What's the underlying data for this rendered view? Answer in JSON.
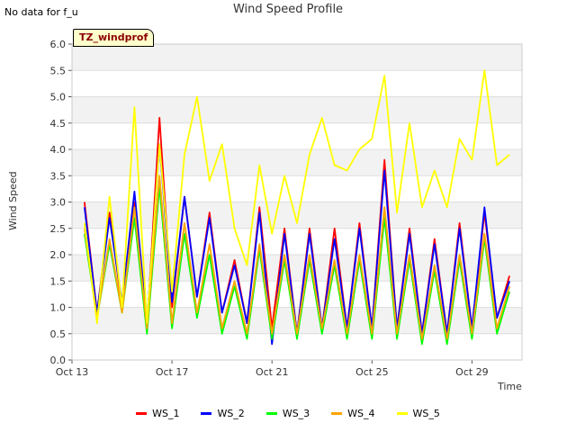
{
  "header": {
    "status_text": "No data for f_u",
    "badge_text": "TZ_windprof"
  },
  "chart_data": {
    "type": "line",
    "title": "Wind Speed Profile",
    "xlabel": "Time",
    "ylabel": "Wind Speed",
    "ylim": [
      0.0,
      6.0
    ],
    "yticks": [
      "0.0",
      "0.5",
      "1.0",
      "1.5",
      "2.0",
      "2.5",
      "3.0",
      "3.5",
      "4.0",
      "4.5",
      "5.0",
      "5.5",
      "6.0"
    ],
    "xlim": [
      "2023-10-13",
      "2023-10-31"
    ],
    "xticks": [
      {
        "label": "Oct 13",
        "date": "2023-10-13"
      },
      {
        "label": "Oct 17",
        "date": "2023-10-17"
      },
      {
        "label": "Oct 21",
        "date": "2023-10-21"
      },
      {
        "label": "Oct 25",
        "date": "2023-10-25"
      },
      {
        "label": "Oct 29",
        "date": "2023-10-29"
      }
    ],
    "grid": true,
    "legend_position": "bottom",
    "x": [
      "2023-10-13 12:00",
      "2023-10-14 00:00",
      "2023-10-14 12:00",
      "2023-10-15 00:00",
      "2023-10-15 12:00",
      "2023-10-16 00:00",
      "2023-10-16 12:00",
      "2023-10-17 00:00",
      "2023-10-17 12:00",
      "2023-10-18 00:00",
      "2023-10-18 12:00",
      "2023-10-19 00:00",
      "2023-10-19 12:00",
      "2023-10-20 00:00",
      "2023-10-20 12:00",
      "2023-10-21 00:00",
      "2023-10-21 12:00",
      "2023-10-22 00:00",
      "2023-10-22 12:00",
      "2023-10-23 00:00",
      "2023-10-23 12:00",
      "2023-10-24 00:00",
      "2023-10-24 12:00",
      "2023-10-25 00:00",
      "2023-10-25 12:00",
      "2023-10-26 00:00",
      "2023-10-26 12:00",
      "2023-10-27 00:00",
      "2023-10-27 12:00",
      "2023-10-28 00:00",
      "2023-10-28 12:00",
      "2023-10-29 00:00",
      "2023-10-29 12:00",
      "2023-10-30 00:00",
      "2023-10-30 12:00"
    ],
    "series": [
      {
        "name": "WS_1",
        "color": "#ff0000",
        "values": [
          3.0,
          0.9,
          2.8,
          1.0,
          3.0,
          0.6,
          4.6,
          1.0,
          3.1,
          1.2,
          2.8,
          0.9,
          1.9,
          0.7,
          2.9,
          0.6,
          2.5,
          0.5,
          2.5,
          0.6,
          2.5,
          0.6,
          2.6,
          0.6,
          3.8,
          0.6,
          2.5,
          0.5,
          2.3,
          0.5,
          2.6,
          0.6,
          2.8,
          0.8,
          1.6
        ]
      },
      {
        "name": "WS_2",
        "color": "#0000ff",
        "values": [
          2.9,
          0.9,
          2.7,
          1.1,
          3.2,
          0.7,
          4.1,
          1.1,
          3.1,
          1.2,
          2.7,
          0.9,
          1.8,
          0.7,
          2.8,
          0.3,
          2.4,
          0.5,
          2.4,
          0.6,
          2.3,
          0.6,
          2.5,
          0.6,
          3.6,
          0.6,
          2.4,
          0.5,
          2.2,
          0.5,
          2.5,
          0.6,
          2.9,
          0.8,
          1.5
        ]
      },
      {
        "name": "WS_3",
        "color": "#00ff00",
        "values": [
          2.4,
          0.8,
          2.2,
          0.9,
          2.7,
          0.5,
          3.3,
          0.6,
          2.4,
          0.8,
          2.0,
          0.5,
          1.4,
          0.4,
          2.1,
          0.4,
          1.9,
          0.4,
          1.9,
          0.5,
          1.8,
          0.4,
          1.9,
          0.4,
          2.7,
          0.4,
          1.9,
          0.3,
          1.7,
          0.3,
          1.9,
          0.4,
          2.3,
          0.5,
          1.3
        ]
      },
      {
        "name": "WS_4",
        "color": "#ffa500",
        "values": [
          2.5,
          0.8,
          2.3,
          0.9,
          2.9,
          0.6,
          3.5,
          0.7,
          2.6,
          0.9,
          2.2,
          0.6,
          1.5,
          0.5,
          2.2,
          0.5,
          2.0,
          0.5,
          2.0,
          0.6,
          1.9,
          0.5,
          2.0,
          0.5,
          2.9,
          0.5,
          2.0,
          0.4,
          1.8,
          0.4,
          2.0,
          0.5,
          2.4,
          0.6,
          1.4
        ]
      },
      {
        "name": "WS_5",
        "color": "#ffff00",
        "values": [
          2.6,
          0.7,
          3.1,
          1.0,
          4.8,
          0.7,
          4.1,
          1.3,
          3.9,
          5.0,
          3.4,
          4.1,
          2.5,
          1.8,
          3.7,
          2.4,
          3.5,
          2.6,
          3.9,
          4.6,
          3.7,
          3.6,
          4.0,
          4.2,
          5.4,
          2.8,
          4.5,
          2.9,
          3.6,
          2.9,
          4.2,
          3.8,
          5.5,
          3.7,
          3.9
        ]
      }
    ]
  }
}
